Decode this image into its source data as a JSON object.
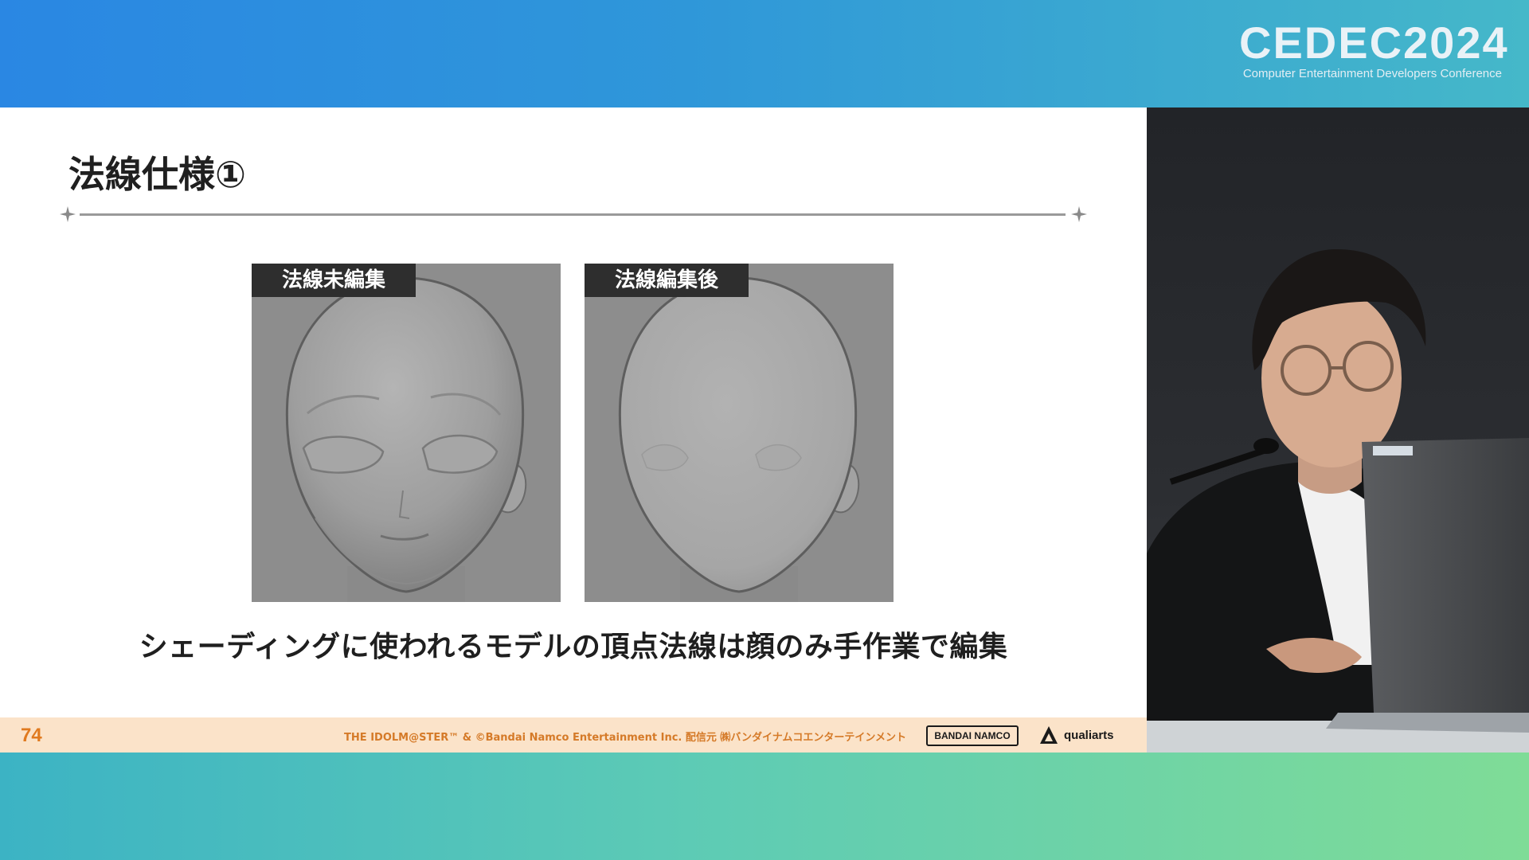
{
  "conference": {
    "logo_text": "CEDEC2024",
    "logo_subtitle": "Computer Entertainment Developers Conference"
  },
  "slide": {
    "title": "法線仕様①",
    "panels": [
      {
        "label": "法線未編集"
      },
      {
        "label": "法線編集後"
      }
    ],
    "caption": "シェーディングに使われるモデルの頂点法線は顔のみ手作業で編集",
    "footer": {
      "page_number": "74",
      "copyright": "THE IDOLM@STER™ & ©Bandai Namco Entertainment Inc.  配信元 ㈱バンダイナムコエンターテインメント",
      "bandai_logo": "BANDAI NAMCO",
      "qualiarts_logo": "qualiarts"
    }
  },
  "colors": {
    "top_band": "#2a87e3",
    "bottom_band": "#7fdc97",
    "footer_bg": "#fbe3c9",
    "footer_text": "#d57a28",
    "page_number": "#e07a1f",
    "label_bg": "#2e2e2e"
  }
}
